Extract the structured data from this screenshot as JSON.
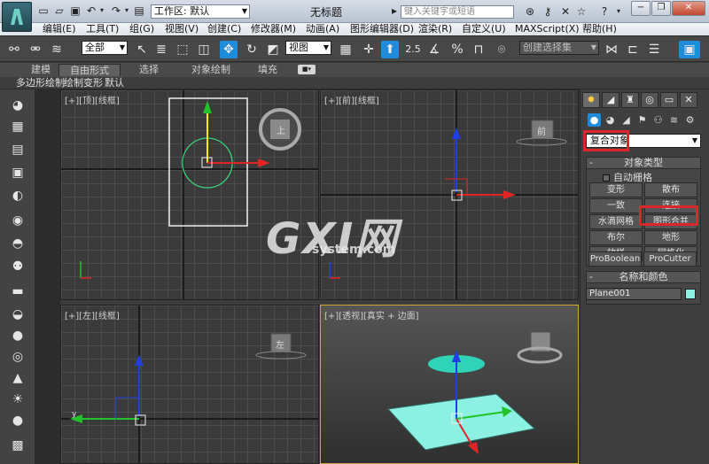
{
  "titlebar": {
    "workspace_label": "工作区: 默认",
    "title": "无标题",
    "search_placeholder": "键入关键字或短语"
  },
  "menubar": {
    "items": [
      "编辑(E)",
      "工具(T)",
      "组(G)",
      "视图(V)",
      "创建(C)",
      "修改器(M)",
      "动画(A)",
      "图形编辑器(D)",
      "渲染(R)",
      "自定义(U)",
      "MAXScript(X)",
      "帮助(H)"
    ]
  },
  "toolbar": {
    "filter_value": "全部",
    "refcoord_value": "视图",
    "snap_value": "2.5",
    "selection_set_value": "创建选择集"
  },
  "ribbon": {
    "tabs": [
      "建模",
      "自由形式",
      "选择",
      "对象绘制",
      "填充"
    ],
    "active_tab": "自由形式",
    "sub_items": [
      "多边形绘制",
      "绘制变形",
      "默认"
    ]
  },
  "viewports": {
    "top_label": "[+][顶][线框]",
    "front_label": "[+][前][线框]",
    "left_label": "[+][左][线框]",
    "persp_label": "[+][透视][真实 + 边面]",
    "viewcube_top": "上",
    "viewcube_front": "前",
    "viewcube_left": "左",
    "axis_y": "y"
  },
  "command_panel": {
    "category_value": "复合对象",
    "object_type_header": "对象类型",
    "autogrid_label": "自动栅格",
    "buttons": [
      "变形",
      "散布",
      "一致",
      "连接",
      "水滴网格",
      "图形合并",
      "布尔",
      "地形",
      "放样",
      "网格化",
      "ProBoolean",
      "ProCutter"
    ],
    "name_color_header": "名称和颜色",
    "object_name": "Plane001",
    "object_color": "#8cf0e2",
    "highlight_color": "#e0242b"
  },
  "watermark": {
    "big": "GXI网",
    "small": "system.com"
  }
}
